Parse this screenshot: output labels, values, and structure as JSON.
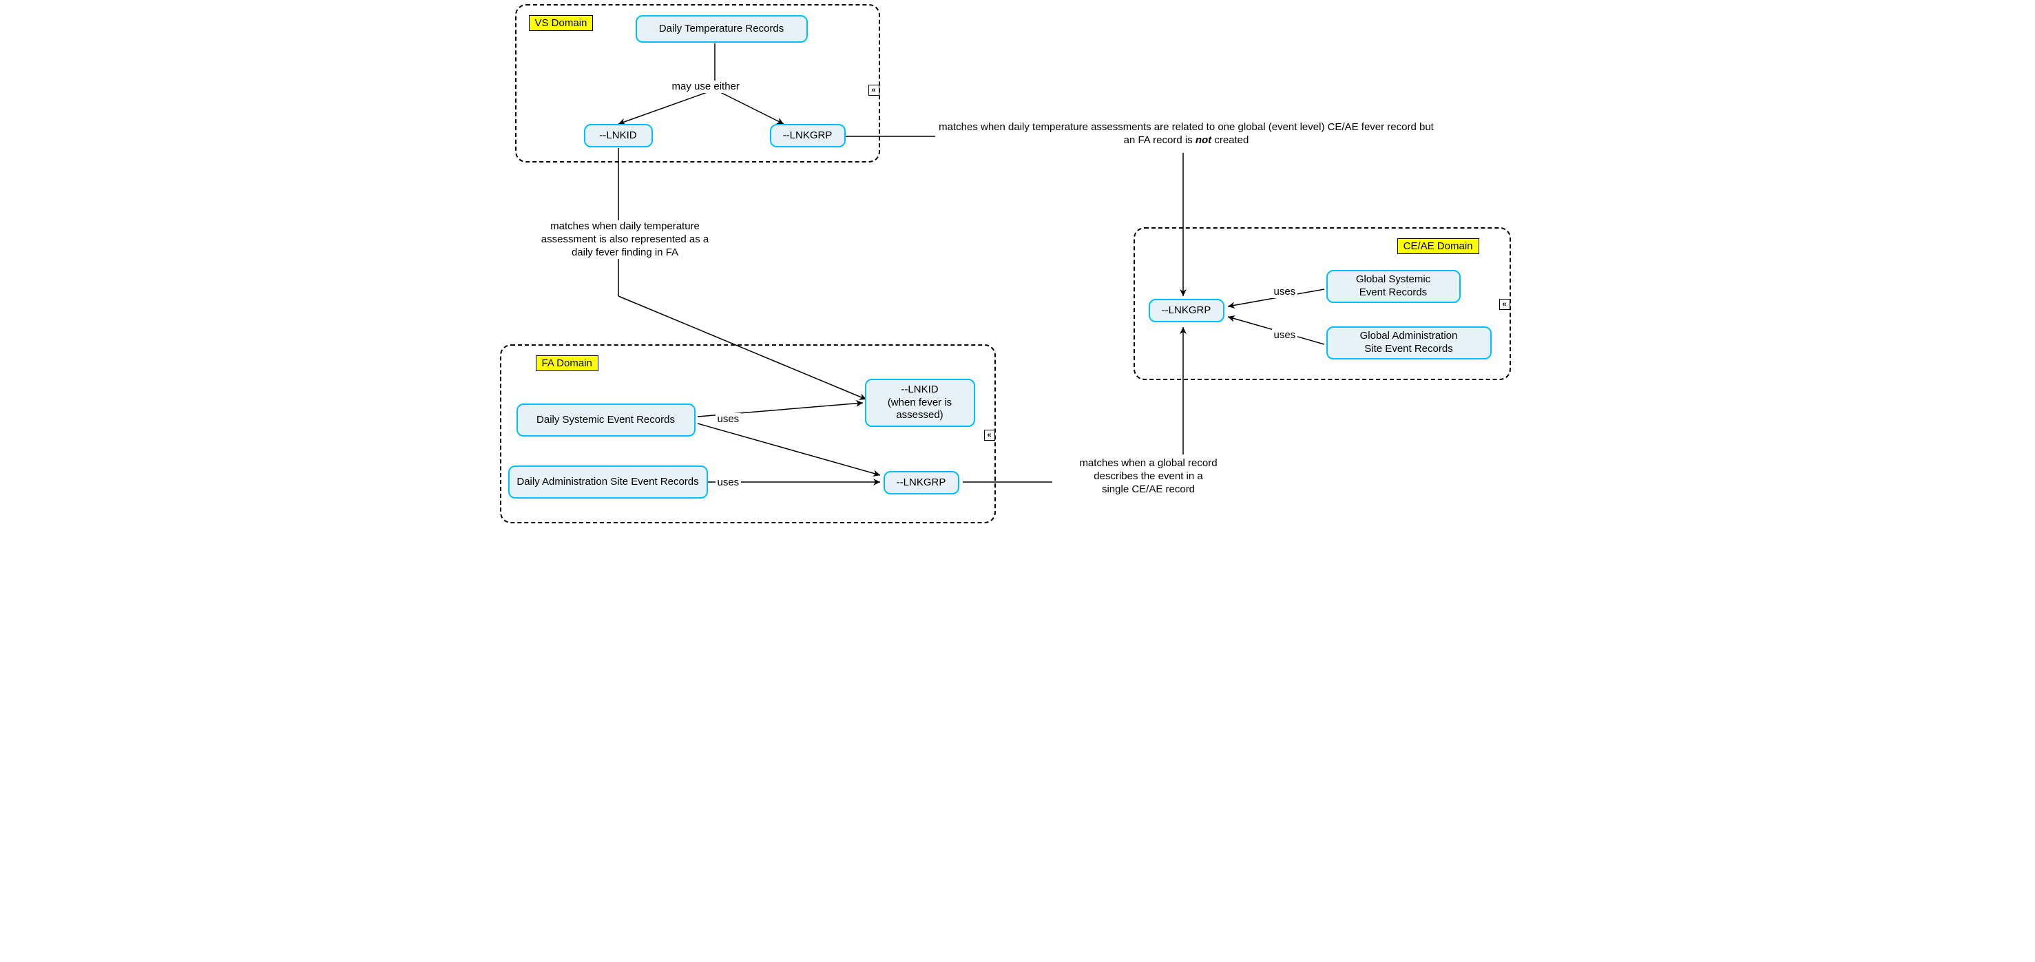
{
  "domains": {
    "vs": {
      "label": "VS Domain"
    },
    "fa": {
      "label": "FA Domain"
    },
    "ce_ae": {
      "label": "CE/AE Domain"
    }
  },
  "nodes": {
    "daily_temp": "Daily Temperature Records",
    "vs_lnkid": "--LNKID",
    "vs_lnkgrp": "--LNKGRP",
    "daily_sys_evt": "Daily Systemic Event Records",
    "daily_admin_site": "Daily Administration Site Event Records",
    "fa_lnkid": "--LNKID\n(when fever is\nassessed)",
    "fa_lnkgrp": "--LNKGRP",
    "ce_lnkgrp": "--LNKGRP",
    "global_sys_evt": "Global Systemic\nEvent Records",
    "global_admin_site": "Global Administration\nSite Event Records"
  },
  "edge_labels": {
    "may_use_either": "may use either",
    "uses": "uses"
  },
  "annotations": {
    "vs_lnkid_match": "matches when daily temperature\nassessment is also represented as a\ndaily fever finding in FA",
    "vs_lnkgrp_match_pre": "matches when daily temperature assessments are related to\none global (event level) CE/AE fever record but an FA record is ",
    "vs_lnkgrp_match_not": "not",
    "vs_lnkgrp_match_post": " created",
    "fa_lnkgrp_match": "matches when a global record\ndescribes the event in a\nsingle CE/AE record"
  },
  "chart_data": {
    "type": "diagram",
    "entities": [
      {
        "id": "vs_domain",
        "type": "container",
        "label": "VS Domain",
        "children": [
          "daily_temp",
          "vs_lnkid",
          "vs_lnkgrp"
        ]
      },
      {
        "id": "fa_domain",
        "type": "container",
        "label": "FA Domain",
        "children": [
          "daily_sys_evt",
          "daily_admin_site",
          "fa_lnkid",
          "fa_lnkgrp"
        ]
      },
      {
        "id": "ce_ae_domain",
        "type": "container",
        "label": "CE/AE Domain",
        "children": [
          "ce_lnkgrp",
          "global_sys_evt",
          "global_admin_site"
        ]
      },
      {
        "id": "daily_temp",
        "label": "Daily Temperature Records"
      },
      {
        "id": "vs_lnkid",
        "label": "--LNKID"
      },
      {
        "id": "vs_lnkgrp",
        "label": "--LNKGRP"
      },
      {
        "id": "daily_sys_evt",
        "label": "Daily Systemic Event Records"
      },
      {
        "id": "daily_admin_site",
        "label": "Daily Administration Site Event Records"
      },
      {
        "id": "fa_lnkid",
        "label": "--LNKID (when fever is assessed)"
      },
      {
        "id": "fa_lnkgrp",
        "label": "--LNKGRP"
      },
      {
        "id": "ce_lnkgrp",
        "label": "--LNKGRP"
      },
      {
        "id": "global_sys_evt",
        "label": "Global Systemic Event Records"
      },
      {
        "id": "global_admin_site",
        "label": "Global Administration Site Event Records"
      }
    ],
    "edges": [
      {
        "from": "daily_temp",
        "to": "vs_lnkid",
        "label": "may use either",
        "directed": true
      },
      {
        "from": "daily_temp",
        "to": "vs_lnkgrp",
        "label": "may use either",
        "directed": true
      },
      {
        "from": "vs_lnkid",
        "to": "fa_lnkid",
        "label": "matches when daily temperature assessment is also represented as a daily fever finding in FA",
        "directed": true
      },
      {
        "from": "vs_lnkgrp",
        "to": "ce_lnkgrp",
        "label": "matches when daily temperature assessments are related to one global (event level) CE/AE fever record but an FA record is not created",
        "directed": true
      },
      {
        "from": "daily_sys_evt",
        "to": "fa_lnkid",
        "label": "uses",
        "directed": true
      },
      {
        "from": "daily_sys_evt",
        "to": "fa_lnkgrp",
        "label": "uses",
        "directed": true
      },
      {
        "from": "daily_admin_site",
        "to": "fa_lnkgrp",
        "label": "uses",
        "directed": true
      },
      {
        "from": "fa_lnkgrp",
        "to": "ce_lnkgrp",
        "label": "matches when a global record describes the event in a single CE/AE record",
        "directed": true
      },
      {
        "from": "global_sys_evt",
        "to": "ce_lnkgrp",
        "label": "uses",
        "directed": true
      },
      {
        "from": "global_admin_site",
        "to": "ce_lnkgrp",
        "label": "uses",
        "directed": true
      }
    ]
  }
}
